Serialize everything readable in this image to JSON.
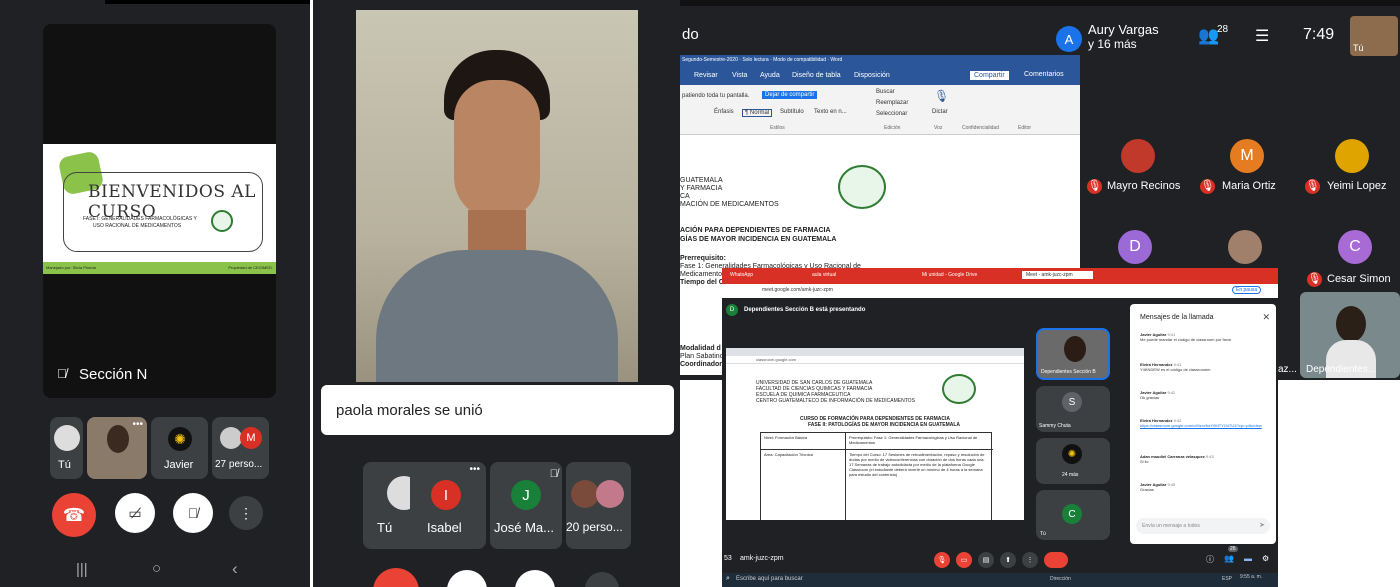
{
  "panel1": {
    "presenter_label": "Sección N",
    "slide_title": "Bienvenidos al curso",
    "slide_subtitle_1": "FASE I: GENERALIDADES FARMACOLÓGICAS Y",
    "slide_subtitle_2": "USO RACIONAL DE MEDICAMENTOS",
    "slide_footer_left": "Manejado por: Silvia Pineda",
    "slide_footer_right": "Propiedad de CEGIMED.",
    "participants": [
      {
        "name": "Tú"
      },
      {
        "name": ""
      },
      {
        "name": "Javier"
      },
      {
        "name": "27 perso..."
      }
    ],
    "avatar_letter_m": "M"
  },
  "panel2": {
    "toast": "paola morales se unió",
    "participants": [
      {
        "name": "Tú",
        "letter": ""
      },
      {
        "name": "Isabel",
        "letter": "I"
      },
      {
        "name": "José Ma...",
        "letter": "J"
      },
      {
        "name": "20 perso...",
        "letter": ""
      }
    ]
  },
  "panel3": {
    "top_partial": "do",
    "header_name": "Aury Vargas",
    "header_more": "y 16 más",
    "header_avatar": "A",
    "people_count": "28",
    "time": "7:49",
    "self_label": "Tú",
    "word_title": "Segundo-Semestre-2020 · Solo lectura · Modo de compatibilidad · Word",
    "word_tabs": [
      "Revisar",
      "Vista",
      "Ayuda",
      "Diseño de tabla",
      "Disposición"
    ],
    "word_share": "Compartir",
    "word_comments": "Comentarios",
    "word_sharing_text": "patiendo toda tu pantalla.",
    "word_stop_share": "Dejar de compartir",
    "word_styles": [
      "Énfasis",
      "¶ Normal",
      "Subtítulo",
      "Texto en n..."
    ],
    "word_group_estilos": "Estilos",
    "word_group_edicion": "Edición",
    "word_group_voz": "Voz",
    "word_group_conf": "Confidencialidad",
    "word_group_editor": "Editor",
    "word_find": "Buscar",
    "word_replace": "Reemplazar",
    "word_select": "Seleccionar",
    "word_dictate": "Dictar",
    "doc_lines": [
      "GUATEMALA",
      "Y FARMACIA",
      "CA",
      "MACIÓN DE MEDICAMENTOS"
    ],
    "doc_heading_1": "ACIÓN PARA DEPENDIENTES DE FARMACIA",
    "doc_heading_2": "GÍAS DE MAYOR INCIDENCIA EN GUATEMALA",
    "doc_prereq": "Prerrequisito:",
    "doc_fase": "Fase 1: Generalidades Farmacológicas y Uso Racional de",
    "doc_medicamentos": "Medicamentos",
    "doc_tiempo": "Tiempo del C",
    "doc_modalidad": "Modalidad d",
    "doc_plan": "Plan Sabatino",
    "doc_coord": "Coordinador",
    "grid": [
      {
        "name": "Mayro Recinos",
        "letter": "",
        "color": "#c0392b"
      },
      {
        "name": "Maria Ortiz",
        "letter": "M",
        "color": "#e67c22"
      },
      {
        "name": "Yeimi Lopez",
        "letter": "",
        "color": "#e0a400"
      },
      {
        "name": "",
        "letter": "D",
        "color": "#9c6ad6"
      },
      {
        "name": "",
        "letter": "",
        "color": "#a0806a"
      },
      {
        "name": "Cesar Simon",
        "letter": "C",
        "color": "#a86bd6"
      }
    ],
    "partial_name": "az...",
    "dependientes_label": "Dependientes..."
  },
  "panel4": {
    "tabs": [
      "WhatsApp",
      "aula virtual",
      "Mi unidad - Google Drive",
      "Meet - amk-juzc-zpm"
    ],
    "url": "meet.google.com/amk-juzc-zpm",
    "paused": "En pausa",
    "presenting_banner": "Dependientes Sección B está presentando",
    "presenting_avatar": "D",
    "inner_url": "classroom.google.com",
    "inner_doc_lines": [
      "UNIVERSIDAD DE SAN CARLOS DE GUATEMALA",
      "FACULTAD DE CIENCIAS QUIMICAS Y FARMACIA",
      "ESCUELA DE QUIMICA FARMACEUTICA",
      "CENTRO GUATEMALTECO DE INFORMACIÓN DE MEDICAMENTOS"
    ],
    "inner_heading_1": "CURSO DE FORMACIÓN PARA DEPENDIENTES DE FARMACIA",
    "inner_heading_2": "FASE II: PATOLOGÍAS DE MAYOR INCIDENCIA EN GUATEMALA",
    "table_rows": [
      {
        "c1": "Nivel: Formación Básica",
        "c2": "Prerrequisito: Fase 1: Generalidades Farmacológicas y Uso Racional de Medicamentos"
      },
      {
        "c1": "Área: Capacitación Técnica",
        "c2": "Tiempo del Curso: 17 Sesiones de retroalimentación, repaso y resolución de dudas por medio de videoconferencias con duración de dos horas cada una. 17 Semanas de trabajo autodidacta por medio de la plataforma Google Classroom (el estudiante deberá invertir un mínimo de 4 horas a la semana para estudio del contenido)"
      }
    ],
    "side_tiles": [
      {
        "name": "Dependientes Sección B",
        "letter": ""
      },
      {
        "name": "Sammy Chuta",
        "letter": "S"
      },
      {
        "name": "24 más",
        "letter": ""
      },
      {
        "name": "Tú",
        "letter": "C"
      }
    ],
    "chat_title": "Mensajes de la llamada",
    "chat": [
      {
        "who": "Javier Aguilar",
        "time": "9:41",
        "text": "Me puede mandar el código de classroom por favor"
      },
      {
        "who": "Elvira Hernandez",
        "time": "9:41",
        "text": "Y4KNDEW es el código de classroomm"
      },
      {
        "who": "Javier Aguilar",
        "time": "9:42",
        "text": "Ok gracias"
      },
      {
        "who": "Elvira Hernandez",
        "time": "9:42",
        "text": "https://classroom.google.com/c/MzcxNzY0MTY1NTU3?cjc=y4kndew"
      },
      {
        "who": "Adan maudiel Carranza velasquez",
        "time": "9:43",
        "text": "Si lic"
      },
      {
        "who": "Javier Aguilar",
        "time": "9:45",
        "text": "Gracias"
      }
    ],
    "chat_placeholder": "Envía un mensaje a todos",
    "meeting_code": "amk-juzc-zpm",
    "meeting_prefix": "53",
    "people_count": "26",
    "taskbar_search": "Escribe aquí para buscar",
    "taskbar_dir": "Dirección",
    "taskbar_lang": "ESP",
    "taskbar_time": "9:55 a. m."
  },
  "colors": {
    "meet_dark": "#202124",
    "tile": "#3c4043",
    "red": "#ea4335",
    "green": "#8bc34a"
  }
}
